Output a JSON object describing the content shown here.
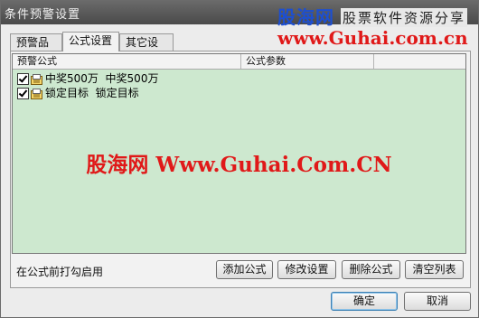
{
  "window": {
    "title": "条件预警设置"
  },
  "watermark_top": {
    "logo": "股海网",
    "slogan": "股票软件资源分享",
    "url": "www.Guhai.com.cn"
  },
  "tabs": [
    {
      "label": "预警品种",
      "active": false
    },
    {
      "label": "公式设置",
      "active": true
    },
    {
      "label": "其它设置",
      "active": false
    }
  ],
  "list": {
    "columns": [
      "预警公式",
      "公式参数"
    ],
    "rows": [
      {
        "name": "中奖500万",
        "desc": "中奖500万",
        "checked": true
      },
      {
        "name": "锁定目标",
        "desc": "锁定目标",
        "checked": true
      }
    ]
  },
  "watermark_center": "股海网 Www.Guhai.Com.CN",
  "hint": "在公式前打勾启用",
  "actions": {
    "add": "添加公式",
    "edit": "修改设置",
    "delete": "删除公式",
    "clear": "清空列表"
  },
  "footer": {
    "ok": "确定",
    "cancel": "取消"
  },
  "colors": {
    "list_bg": "#cde8cf",
    "watermark_red": "#e01919",
    "watermark_blue": "#1d4fd0"
  }
}
